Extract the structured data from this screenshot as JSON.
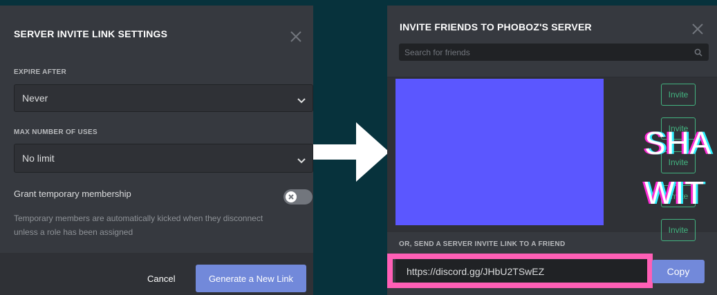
{
  "left_modal": {
    "title": "SERVER INVITE LINK SETTINGS",
    "expire_label": "EXPIRE AFTER",
    "expire_value": "Never",
    "max_uses_label": "MAX NUMBER OF USES",
    "max_uses_value": "No limit",
    "grant_label": "Grant temporary membership",
    "grant_enabled": false,
    "grant_desc_line1": "Temporary members are automatically kicked when they disconnect",
    "grant_desc_line2": "unless a role has been assigned",
    "cancel_label": "Cancel",
    "generate_label": "Generate a New Link"
  },
  "right_modal": {
    "title": "INVITE FRIENDS TO PHOBOZ'S SERVER",
    "search_placeholder": "Search for friends",
    "invite_buttons": [
      "Invite",
      "Invite",
      "Invite",
      "Invite",
      "Invite"
    ],
    "overlay_line1": "SHA",
    "overlay_line2": "WIT",
    "link_section_label": "OR, SEND A SERVER INVITE LINK TO A FRIEND",
    "invite_link": "https://discord.gg/JHbU2TSwEZ",
    "copy_label": "Copy"
  },
  "colors": {
    "background": "#07323c",
    "modal_bg": "#36393f",
    "blurple": "#7289da",
    "green": "#43b581",
    "redaction": "#5b57ff",
    "highlight": "#ff5fb6"
  },
  "icons": [
    "close-icon",
    "chevron-down-icon",
    "toggle-x-icon",
    "search-icon",
    "arrow-right-icon"
  ]
}
